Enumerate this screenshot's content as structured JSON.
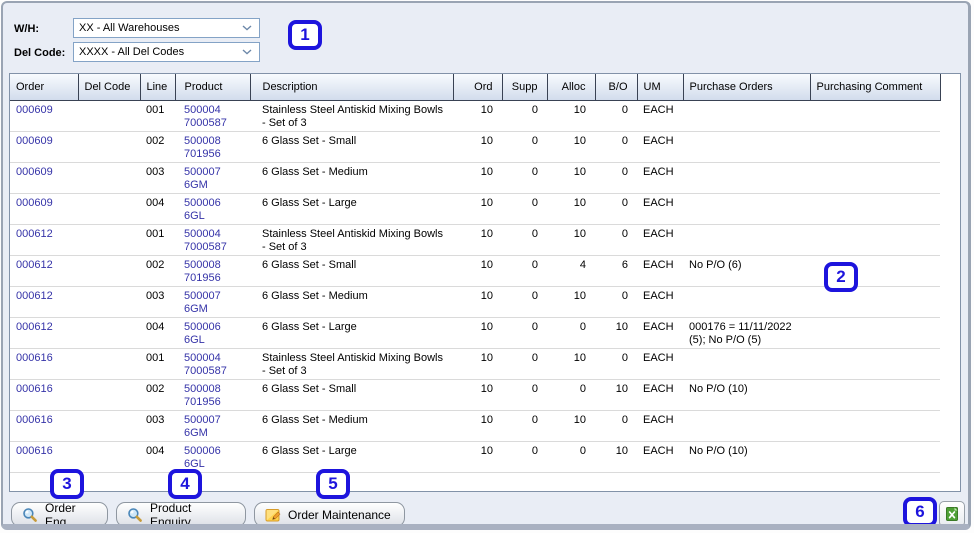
{
  "filters": {
    "wh_label": "W/H:",
    "wh_value": "XX - All Warehouses",
    "del_label": "Del Code:",
    "del_value": "XXXX - All Del Codes"
  },
  "table": {
    "columns": [
      {
        "key": "order",
        "label": "Order"
      },
      {
        "key": "del_code",
        "label": "Del Code"
      },
      {
        "key": "line",
        "label": "Line"
      },
      {
        "key": "product",
        "label": "Product"
      },
      {
        "key": "description",
        "label": "Description"
      },
      {
        "key": "ord",
        "label": "Ord"
      },
      {
        "key": "supp",
        "label": "Supp"
      },
      {
        "key": "alloc",
        "label": "Alloc"
      },
      {
        "key": "bo",
        "label": "B/O"
      },
      {
        "key": "um",
        "label": "UM"
      },
      {
        "key": "po",
        "label": "Purchase Orders"
      },
      {
        "key": "comment",
        "label": "Purchasing Comment"
      }
    ],
    "rows": [
      {
        "order": "000609",
        "del_code": "",
        "line": "001",
        "product": [
          "500004",
          "7000587"
        ],
        "description": "Stainless Steel Antiskid Mixing Bowls - Set of 3",
        "ord": "10",
        "supp": "0",
        "alloc": "10",
        "bo": "0",
        "um": "EACH",
        "po": "",
        "comment": ""
      },
      {
        "order": "000609",
        "del_code": "",
        "line": "002",
        "product": [
          "500008",
          "701956"
        ],
        "description": "6 Glass Set - Small",
        "ord": "10",
        "supp": "0",
        "alloc": "10",
        "bo": "0",
        "um": "EACH",
        "po": "",
        "comment": ""
      },
      {
        "order": "000609",
        "del_code": "",
        "line": "003",
        "product": [
          "500007",
          "6GM"
        ],
        "description": "6 Glass Set - Medium",
        "ord": "10",
        "supp": "0",
        "alloc": "10",
        "bo": "0",
        "um": "EACH",
        "po": "",
        "comment": ""
      },
      {
        "order": "000609",
        "del_code": "",
        "line": "004",
        "product": [
          "500006",
          "6GL"
        ],
        "description": "6 Glass Set - Large",
        "ord": "10",
        "supp": "0",
        "alloc": "10",
        "bo": "0",
        "um": "EACH",
        "po": "",
        "comment": ""
      },
      {
        "order": "000612",
        "del_code": "",
        "line": "001",
        "product": [
          "500004",
          "7000587"
        ],
        "description": "Stainless Steel Antiskid Mixing Bowls - Set of 3",
        "ord": "10",
        "supp": "0",
        "alloc": "10",
        "bo": "0",
        "um": "EACH",
        "po": "",
        "comment": ""
      },
      {
        "order": "000612",
        "del_code": "",
        "line": "002",
        "product": [
          "500008",
          "701956"
        ],
        "description": "6 Glass Set - Small",
        "ord": "10",
        "supp": "0",
        "alloc": "4",
        "bo": "6",
        "um": "EACH",
        "po": "No P/O (6)",
        "comment": ""
      },
      {
        "order": "000612",
        "del_code": "",
        "line": "003",
        "product": [
          "500007",
          "6GM"
        ],
        "description": "6 Glass Set - Medium",
        "ord": "10",
        "supp": "0",
        "alloc": "10",
        "bo": "0",
        "um": "EACH",
        "po": "",
        "comment": ""
      },
      {
        "order": "000612",
        "del_code": "",
        "line": "004",
        "product": [
          "500006",
          "6GL"
        ],
        "description": "6 Glass Set - Large",
        "ord": "10",
        "supp": "0",
        "alloc": "0",
        "bo": "10",
        "um": "EACH",
        "po": "000176 = 11/11/2022 (5); No P/O (5)",
        "comment": ""
      },
      {
        "order": "000616",
        "del_code": "",
        "line": "001",
        "product": [
          "500004",
          "7000587"
        ],
        "description": "Stainless Steel Antiskid Mixing Bowls - Set of 3",
        "ord": "10",
        "supp": "0",
        "alloc": "10",
        "bo": "0",
        "um": "EACH",
        "po": "",
        "comment": ""
      },
      {
        "order": "000616",
        "del_code": "",
        "line": "002",
        "product": [
          "500008",
          "701956"
        ],
        "description": "6 Glass Set - Small",
        "ord": "10",
        "supp": "0",
        "alloc": "0",
        "bo": "10",
        "um": "EACH",
        "po": "No P/O (10)",
        "comment": ""
      },
      {
        "order": "000616",
        "del_code": "",
        "line": "003",
        "product": [
          "500007",
          "6GM"
        ],
        "description": "6 Glass Set - Medium",
        "ord": "10",
        "supp": "0",
        "alloc": "10",
        "bo": "0",
        "um": "EACH",
        "po": "",
        "comment": ""
      },
      {
        "order": "000616",
        "del_code": "",
        "line": "004",
        "product": [
          "500006",
          "6GL"
        ],
        "description": "6 Glass Set - Large",
        "ord": "10",
        "supp": "0",
        "alloc": "0",
        "bo": "10",
        "um": "EACH",
        "po": "No P/O (10)",
        "comment": ""
      }
    ]
  },
  "buttons": {
    "order_enq": "Order Enq",
    "product_enquiry": "Product Enquiry",
    "order_maintenance": "Order Maintenance"
  },
  "icons": {
    "order_enq": "search-icon",
    "product_enquiry": "search-icon",
    "order_maintenance": "note-edit-icon",
    "export": "excel-icon",
    "dropdown": "chevron-down-icon"
  },
  "annotations": [
    "1",
    "2",
    "3",
    "4",
    "5",
    "6"
  ],
  "colors": {
    "link": "#3533a8",
    "annotation_blue": "#1d14dd",
    "header_gradient_top": "#f8fbfe",
    "header_gradient_bottom": "#d2dcec",
    "panel_background": "#e9edf5",
    "excel_green": "#4ea035"
  }
}
